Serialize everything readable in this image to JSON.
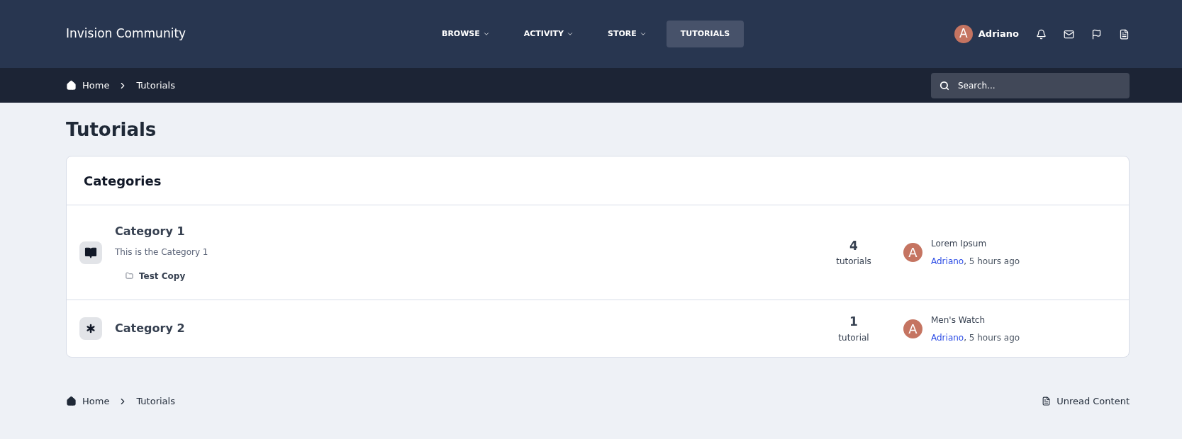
{
  "site": {
    "title": "Invision Community"
  },
  "nav": [
    {
      "label": "BROWSE",
      "dropdown": true,
      "selected": false
    },
    {
      "label": "ACTIVITY",
      "dropdown": true,
      "selected": false
    },
    {
      "label": "STORE",
      "dropdown": true,
      "selected": false
    },
    {
      "label": "TUTORIALS",
      "dropdown": false,
      "selected": true
    }
  ],
  "user": {
    "avatar": "A",
    "name": "Adriano"
  },
  "breadcrumb": [
    "Home",
    "Tutorials"
  ],
  "search": {
    "placeholder": "Search..."
  },
  "page_title": "Tutorials",
  "categories": {
    "heading": "Categories",
    "rows": [
      {
        "kind": "book",
        "title": "Category 1",
        "description": "This is the Category 1",
        "subcategories": [
          "Test Copy"
        ],
        "count": "4",
        "count_label": "tutorials",
        "last": {
          "avatar": "A",
          "title": "Lorem Ipsum",
          "author": "Adriano",
          "time": ", 5 hours ago"
        }
      },
      {
        "kind": "asterisk",
        "title": "Category 2",
        "count": "1",
        "count_label": "tutorial",
        "last": {
          "avatar": "A",
          "title": "Men's Watch",
          "author": "Adriano",
          "time": ", 5 hours ago"
        }
      }
    ]
  },
  "footer": {
    "breadcrumb": [
      "Home",
      "Tutorials"
    ],
    "unread": "Unread Content"
  }
}
